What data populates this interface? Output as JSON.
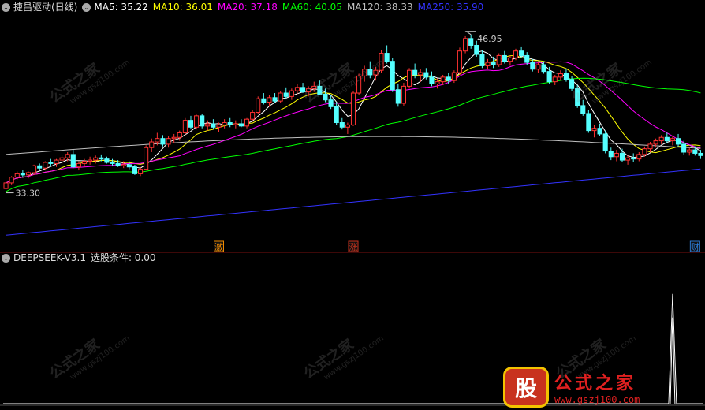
{
  "legend": {
    "stock": "捷昌驱动(日线)",
    "ma": [
      {
        "label": "MA5: 35.22",
        "color": "#ffffff"
      },
      {
        "label": "MA10: 36.01",
        "color": "#ffff00"
      },
      {
        "label": "MA20: 37.18",
        "color": "#ff00ff"
      },
      {
        "label": "MA60: 40.05",
        "color": "#00ff00"
      },
      {
        "label": "MA120: 38.33",
        "color": "#c0c0c0"
      },
      {
        "label": "MA250: 35.90",
        "color": "#3333ff"
      }
    ]
  },
  "indicator": {
    "name": "DEEPSEEK-V3.1",
    "condition": "选股条件: 0.00"
  },
  "logo": {
    "badge": "股",
    "name": "公式之家",
    "url": "www.gszj100.com"
  },
  "watermark": {
    "text": "公式之家",
    "url": "www.gszj100.com"
  },
  "chart_data": {
    "type": "candlestick",
    "price_range": [
      28.9,
      48.6
    ],
    "annotations": {
      "high": "46.95",
      "low": "33.30"
    },
    "event_markers": [
      {
        "label": "激",
        "index": 38
      },
      {
        "label": "涨",
        "index": 62
      },
      {
        "label": "财",
        "index": 123
      }
    ],
    "candles": [
      [
        33.4,
        34.0,
        33.3,
        33.9
      ],
      [
        33.9,
        34.5,
        33.7,
        34.4
      ],
      [
        34.4,
        34.9,
        34.2,
        34.7
      ],
      [
        34.7,
        35.0,
        34.4,
        34.6
      ],
      [
        34.6,
        34.9,
        34.3,
        34.8
      ],
      [
        34.8,
        35.5,
        34.6,
        35.4
      ],
      [
        35.4,
        35.6,
        35.0,
        35.2
      ],
      [
        35.2,
        35.8,
        35.0,
        35.7
      ],
      [
        35.7,
        36.0,
        35.4,
        35.6
      ],
      [
        35.6,
        36.0,
        35.3,
        35.9
      ],
      [
        35.9,
        36.3,
        35.6,
        36.1
      ],
      [
        36.1,
        36.6,
        35.8,
        36.4
      ],
      [
        36.4,
        36.8,
        35.2,
        35.3
      ],
      [
        35.3,
        35.8,
        35.0,
        35.6
      ],
      [
        35.6,
        36.0,
        35.3,
        35.8
      ],
      [
        35.8,
        36.2,
        35.5,
        35.9
      ],
      [
        35.9,
        36.3,
        35.6,
        36.1
      ],
      [
        36.1,
        36.4,
        35.8,
        36.0
      ],
      [
        36.0,
        36.2,
        35.6,
        35.7
      ],
      [
        35.7,
        36.0,
        35.4,
        35.6
      ],
      [
        35.6,
        35.9,
        35.3,
        35.4
      ],
      [
        35.4,
        35.8,
        35.2,
        35.5
      ],
      [
        35.5,
        35.8,
        35.1,
        35.3
      ],
      [
        35.3,
        35.5,
        34.6,
        34.7
      ],
      [
        34.7,
        35.3,
        34.5,
        35.1
      ],
      [
        35.1,
        37.2,
        35.0,
        37.0
      ],
      [
        37.0,
        37.8,
        36.6,
        37.5
      ],
      [
        37.5,
        38.3,
        37.2,
        37.8
      ],
      [
        37.8,
        38.1,
        37.1,
        37.3
      ],
      [
        37.3,
        38.0,
        37.0,
        37.8
      ],
      [
        37.8,
        38.2,
        37.4,
        37.9
      ],
      [
        37.9,
        38.5,
        37.6,
        38.3
      ],
      [
        38.3,
        39.6,
        38.1,
        39.4
      ],
      [
        39.4,
        39.8,
        38.6,
        38.8
      ],
      [
        38.8,
        39.9,
        38.6,
        39.8
      ],
      [
        39.8,
        40.0,
        38.7,
        38.9
      ],
      [
        38.9,
        39.4,
        38.5,
        39.1
      ],
      [
        39.1,
        39.5,
        38.6,
        38.8
      ],
      [
        38.8,
        39.2,
        38.4,
        39.0
      ],
      [
        39.0,
        39.5,
        38.7,
        39.2
      ],
      [
        39.2,
        39.6,
        38.8,
        39.0
      ],
      [
        39.0,
        39.4,
        38.7,
        39.1
      ],
      [
        39.1,
        39.5,
        38.8,
        38.9
      ],
      [
        38.9,
        39.6,
        38.7,
        39.5
      ],
      [
        39.5,
        40.3,
        39.3,
        40.1
      ],
      [
        40.1,
        41.5,
        40.0,
        41.3
      ],
      [
        41.3,
        41.8,
        40.8,
        41.0
      ],
      [
        41.0,
        41.6,
        40.6,
        41.4
      ],
      [
        41.4,
        41.8,
        40.9,
        41.1
      ],
      [
        41.1,
        42.0,
        40.9,
        41.8
      ],
      [
        41.8,
        42.3,
        41.3,
        41.5
      ],
      [
        41.5,
        42.2,
        41.2,
        42.0
      ],
      [
        42.0,
        42.6,
        41.7,
        42.3
      ],
      [
        42.3,
        42.7,
        41.8,
        41.9
      ],
      [
        41.9,
        42.4,
        41.5,
        42.2
      ],
      [
        42.2,
        42.8,
        41.9,
        42.4
      ],
      [
        42.4,
        42.9,
        41.6,
        41.7
      ],
      [
        41.7,
        42.2,
        41.0,
        41.2
      ],
      [
        41.2,
        41.6,
        40.4,
        40.6
      ],
      [
        40.6,
        41.0,
        39.0,
        39.2
      ],
      [
        39.2,
        39.6,
        38.6,
        38.8
      ],
      [
        38.8,
        39.2,
        38.2,
        39.0
      ],
      [
        39.0,
        42.0,
        38.9,
        41.8
      ],
      [
        41.8,
        43.5,
        41.6,
        43.3
      ],
      [
        43.3,
        44.2,
        42.8,
        43.9
      ],
      [
        43.9,
        44.6,
        43.1,
        43.4
      ],
      [
        43.4,
        44.1,
        42.9,
        43.8
      ],
      [
        43.8,
        45.6,
        43.6,
        45.3
      ],
      [
        45.3,
        46.0,
        44.4,
        44.6
      ],
      [
        44.6,
        44.9,
        41.9,
        42.1
      ],
      [
        42.1,
        42.6,
        40.6,
        40.9
      ],
      [
        40.9,
        42.7,
        40.7,
        42.4
      ],
      [
        42.4,
        44.0,
        42.2,
        43.8
      ],
      [
        43.8,
        44.4,
        43.1,
        43.4
      ],
      [
        43.4,
        43.9,
        42.8,
        43.6
      ],
      [
        43.6,
        44.0,
        43.0,
        43.2
      ],
      [
        43.2,
        43.7,
        42.4,
        42.6
      ],
      [
        42.6,
        43.1,
        42.2,
        42.8
      ],
      [
        42.8,
        43.4,
        42.5,
        43.2
      ],
      [
        43.2,
        43.6,
        42.6,
        42.9
      ],
      [
        42.9,
        43.8,
        42.7,
        43.6
      ],
      [
        43.6,
        45.8,
        43.4,
        45.5
      ],
      [
        45.5,
        46.8,
        45.3,
        46.6
      ],
      [
        46.6,
        46.95,
        45.7,
        46.0
      ],
      [
        46.0,
        46.4,
        45.0,
        45.2
      ],
      [
        45.2,
        45.6,
        44.0,
        44.2
      ],
      [
        44.2,
        44.8,
        43.9,
        44.5
      ],
      [
        44.5,
        45.0,
        44.0,
        44.3
      ],
      [
        44.3,
        45.3,
        44.1,
        45.1
      ],
      [
        45.1,
        45.5,
        44.4,
        44.6
      ],
      [
        44.6,
        45.1,
        44.2,
        44.9
      ],
      [
        44.9,
        45.7,
        44.7,
        45.5
      ],
      [
        45.5,
        45.9,
        44.9,
        45.1
      ],
      [
        45.1,
        45.4,
        44.3,
        44.5
      ],
      [
        44.5,
        44.8,
        43.7,
        43.9
      ],
      [
        43.9,
        44.5,
        43.6,
        44.3
      ],
      [
        44.3,
        44.6,
        43.5,
        43.7
      ],
      [
        43.7,
        44.1,
        42.6,
        42.8
      ],
      [
        42.8,
        43.4,
        42.5,
        43.2
      ],
      [
        43.2,
        43.8,
        42.9,
        43.5
      ],
      [
        43.5,
        43.9,
        42.8,
        43.0
      ],
      [
        43.0,
        43.3,
        42.0,
        42.2
      ],
      [
        42.2,
        42.5,
        40.5,
        40.7
      ],
      [
        40.7,
        41.2,
        39.8,
        40.0
      ],
      [
        40.0,
        40.3,
        38.3,
        38.5
      ],
      [
        38.5,
        39.0,
        37.9,
        38.7
      ],
      [
        38.7,
        39.1,
        38.0,
        38.2
      ],
      [
        38.2,
        38.5,
        36.5,
        36.7
      ],
      [
        36.7,
        37.0,
        35.9,
        36.2
      ],
      [
        36.2,
        36.8,
        35.8,
        36.5
      ],
      [
        36.5,
        36.9,
        35.7,
        35.9
      ],
      [
        35.9,
        36.3,
        35.5,
        36.1
      ],
      [
        36.1,
        36.5,
        35.7,
        36.0
      ],
      [
        36.0,
        36.6,
        35.8,
        36.4
      ],
      [
        36.4,
        37.1,
        36.2,
        36.9
      ],
      [
        36.9,
        37.5,
        36.6,
        37.3
      ],
      [
        37.3,
        37.8,
        37.0,
        37.6
      ],
      [
        37.6,
        38.1,
        37.3,
        37.9
      ],
      [
        37.9,
        38.3,
        37.4,
        37.6
      ],
      [
        37.6,
        38.0,
        37.2,
        37.8
      ],
      [
        37.8,
        38.2,
        37.1,
        37.3
      ],
      [
        37.3,
        37.6,
        36.4,
        36.6
      ],
      [
        36.6,
        37.0,
        36.3,
        36.8
      ],
      [
        36.8,
        37.1,
        36.3,
        36.5
      ],
      [
        36.5,
        36.8,
        36.0,
        36.3
      ]
    ],
    "indicator_series": {
      "name": "选股条件",
      "range": [
        0,
        1.25
      ],
      "spike": {
        "index": 119,
        "value": 1
      }
    }
  }
}
